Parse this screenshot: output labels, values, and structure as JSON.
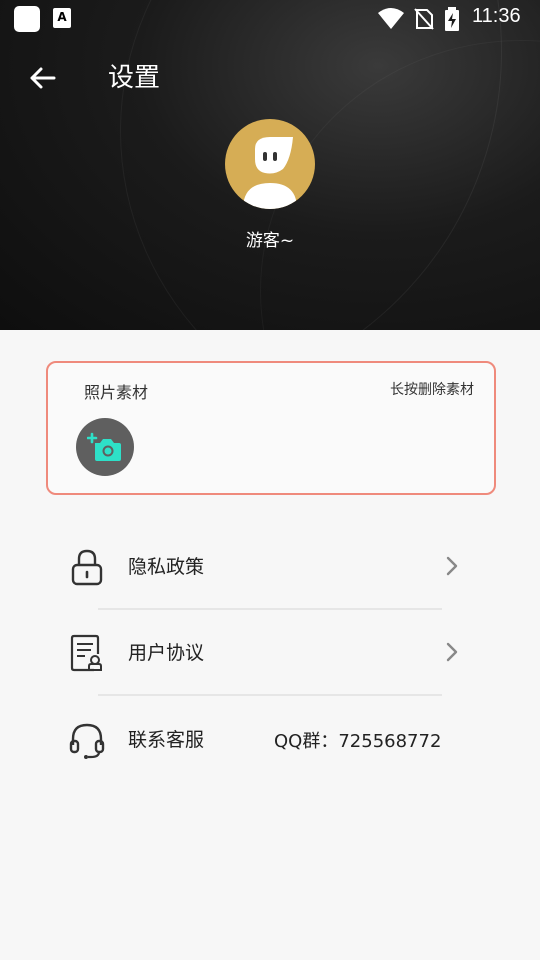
{
  "status_bar": {
    "app2_letter": "A",
    "time": "11:36"
  },
  "header": {
    "title": "设置",
    "nickname": "游客~"
  },
  "photo_card": {
    "title": "照片素材",
    "hint": "长按删除素材"
  },
  "menu": {
    "privacy": {
      "label": "隐私政策",
      "icon": "lock-icon"
    },
    "agreement": {
      "label": "用户协议",
      "icon": "document-icon"
    },
    "service": {
      "label": "联系客服",
      "icon": "headset-icon",
      "value": "QQ群：725568772"
    }
  },
  "colors": {
    "card_border": "#ef8a7c",
    "avatar_bg": "#d6ad55",
    "camera_accent": "#2ee0c8"
  }
}
